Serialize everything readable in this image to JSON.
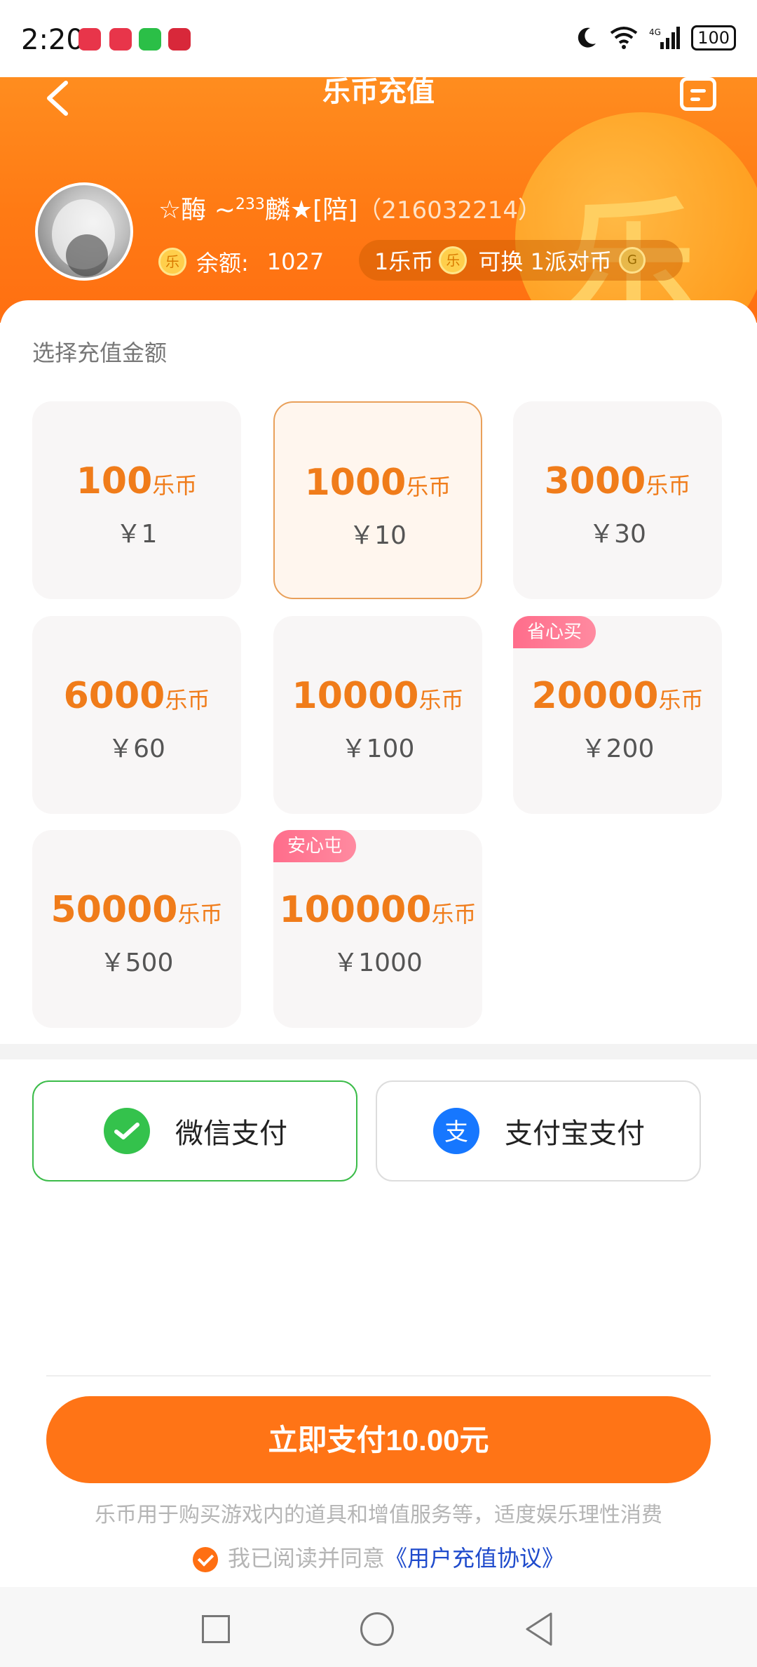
{
  "status_bar": {
    "time": "2:20",
    "app_icons": [
      "huawei-app-icon",
      "huawei-app-icon",
      "wechat-icon",
      "netease-music-icon"
    ],
    "battery": "100"
  },
  "header": {
    "title": "乐币充值",
    "user": {
      "name_prefix": "☆酶 ~",
      "name_sup": "233",
      "name_suffix": "麟★[陪]",
      "uid": "（216032214）"
    },
    "balance_label": "余额:",
    "balance_value": "1027",
    "exchange": {
      "left": "1乐币",
      "middle": "可换 1派对币"
    },
    "coin_glyph": "乐"
  },
  "recharge": {
    "section_title": "选择充值金额",
    "unit": "乐币",
    "options": [
      {
        "coins": "100",
        "price": "￥1",
        "selected": false,
        "badge": ""
      },
      {
        "coins": "1000",
        "price": "￥10",
        "selected": true,
        "badge": ""
      },
      {
        "coins": "3000",
        "price": "￥30",
        "selected": false,
        "badge": ""
      },
      {
        "coins": "6000",
        "price": "￥60",
        "selected": false,
        "badge": ""
      },
      {
        "coins": "10000",
        "price": "￥100",
        "selected": false,
        "badge": ""
      },
      {
        "coins": "20000",
        "price": "￥200",
        "selected": false,
        "badge": "省心买"
      },
      {
        "coins": "50000",
        "price": "￥500",
        "selected": false,
        "badge": ""
      },
      {
        "coins": "100000",
        "price": "￥1000",
        "selected": false,
        "badge": "安心屯"
      }
    ]
  },
  "payment": {
    "wechat_label": "微信支付",
    "alipay_label": "支付宝支付",
    "selected": "wechat"
  },
  "footer": {
    "pay_button": "立即支付10.00元",
    "disclaimer": "乐币用于购买游戏内的道具和增值服务等，适度娱乐理性消费",
    "agree_text": "我已阅读并同意",
    "agree_link": "《用户充值协议》"
  },
  "colors": {
    "accent": "#ff7416",
    "header_orange": "#ff8d1f",
    "badge_pink": "#ff6d8b",
    "wechat_green": "#3cbc4a",
    "alipay_blue": "#1677ff"
  }
}
